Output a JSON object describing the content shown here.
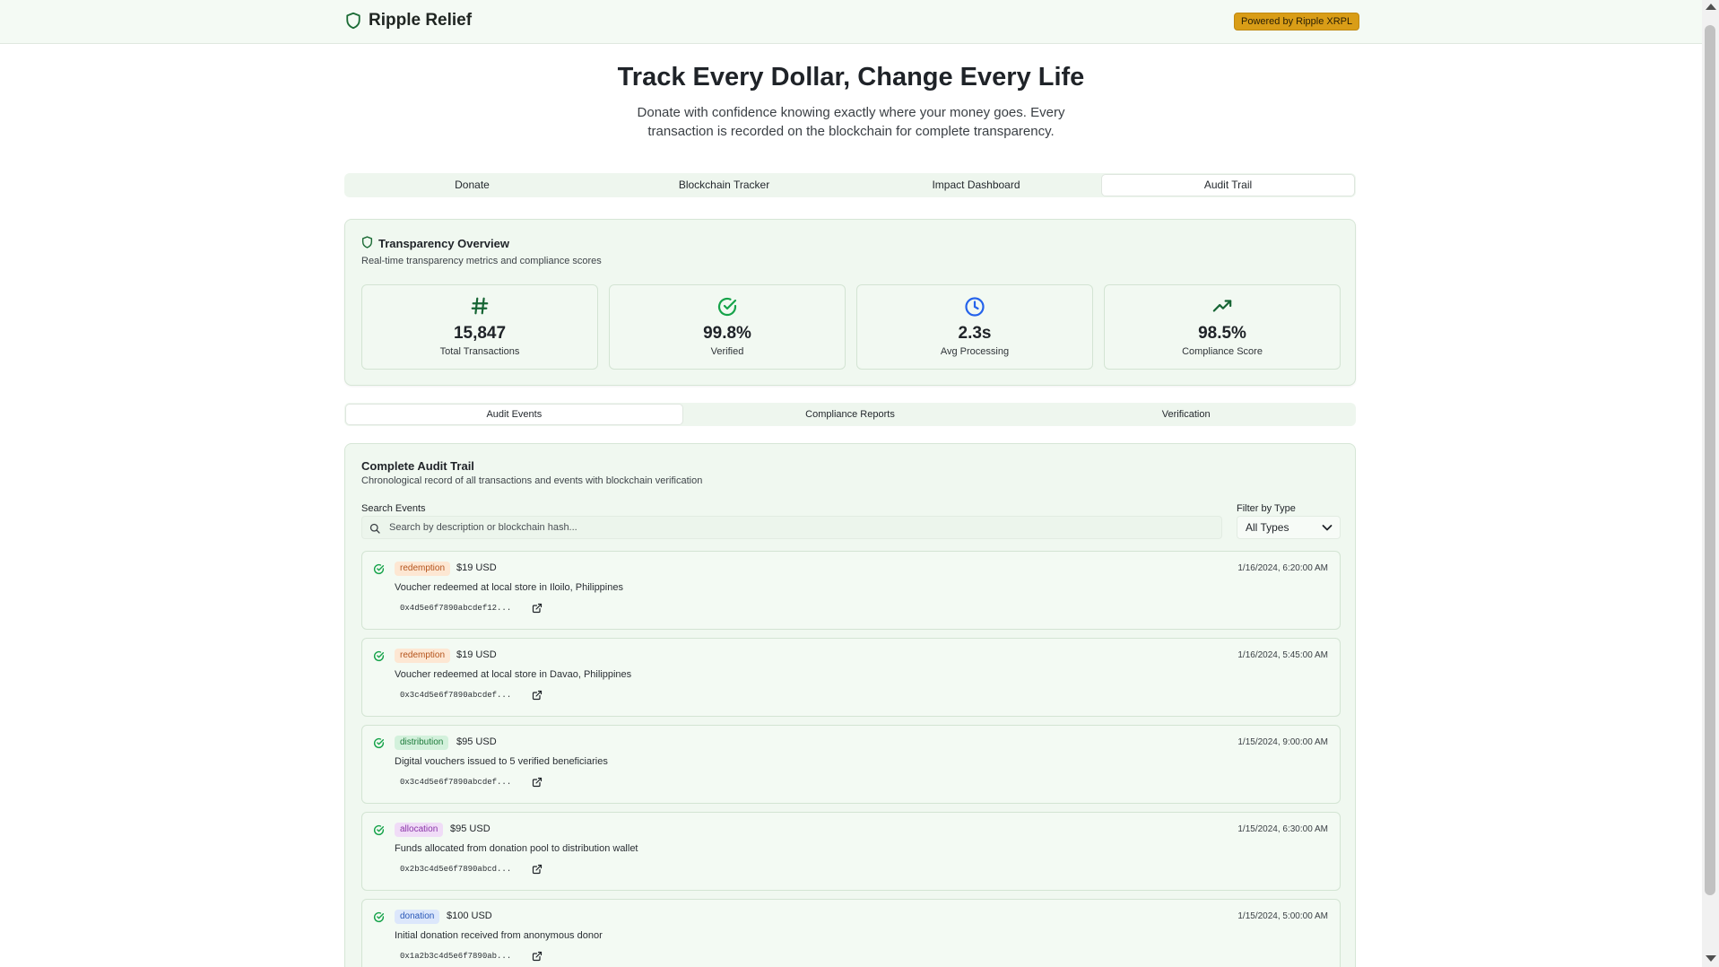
{
  "header": {
    "brand": "Ripple Relief",
    "powered_badge": "Powered by Ripple XRPL"
  },
  "hero": {
    "title": "Track Every Dollar, Change Every Life",
    "subtitle": "Donate with confidence knowing exactly where your money goes. Every transaction is recorded on the blockchain for complete transparency."
  },
  "main_tabs": [
    {
      "label": "Donate",
      "active": false
    },
    {
      "label": "Blockchain Tracker",
      "active": false
    },
    {
      "label": "Impact Dashboard",
      "active": false
    },
    {
      "label": "Audit Trail",
      "active": true
    }
  ],
  "overview": {
    "title": "Transparency Overview",
    "subtitle": "Real-time transparency metrics and compliance scores",
    "stats": [
      {
        "icon": "hash-icon",
        "value": "15,847",
        "label": "Total Transactions",
        "color": "#166534"
      },
      {
        "icon": "check-circle-icon",
        "value": "99.8%",
        "label": "Verified",
        "color": "#16a34a"
      },
      {
        "icon": "clock-icon",
        "value": "2.3s",
        "label": "Avg Processing",
        "color": "#2563eb"
      },
      {
        "icon": "trending-up-icon",
        "value": "98.5%",
        "label": "Compliance Score",
        "color": "#166534"
      }
    ]
  },
  "sub_tabs": [
    {
      "label": "Audit Events",
      "active": true
    },
    {
      "label": "Compliance Reports",
      "active": false
    },
    {
      "label": "Verification",
      "active": false
    }
  ],
  "audit": {
    "title": "Complete Audit Trail",
    "subtitle": "Chronological record of all transactions and events with blockchain verification",
    "search_label": "Search Events",
    "search_placeholder": "Search by description or blockchain hash...",
    "filter_label": "Filter by Type",
    "filter_value": "All Types",
    "events": [
      {
        "type": "redemption",
        "amount": "$19 USD",
        "description": "Voucher redeemed at local store in Iloilo, Philippines",
        "hash": "0x4d5e6f7890abcdef12...",
        "date": "1/16/2024, 6:20:00 AM"
      },
      {
        "type": "redemption",
        "amount": "$19 USD",
        "description": "Voucher redeemed at local store in Davao, Philippines",
        "hash": "0x3c4d5e6f7890abcdef...",
        "date": "1/16/2024, 5:45:00 AM"
      },
      {
        "type": "distribution",
        "amount": "$95 USD",
        "description": "Digital vouchers issued to 5 verified beneficiaries",
        "hash": "0x3c4d5e6f7890abcdef...",
        "date": "1/15/2024, 9:00:00 AM"
      },
      {
        "type": "allocation",
        "amount": "$95 USD",
        "description": "Funds allocated from donation pool to distribution wallet",
        "hash": "0x2b3c4d5e6f7890abcd...",
        "date": "1/15/2024, 6:30:00 AM"
      },
      {
        "type": "donation",
        "amount": "$100 USD",
        "description": "Initial donation received from anonymous donor",
        "hash": "0x1a2b3c4d5e6f7890ab...",
        "date": "1/15/2024, 5:00:00 AM"
      }
    ]
  }
}
